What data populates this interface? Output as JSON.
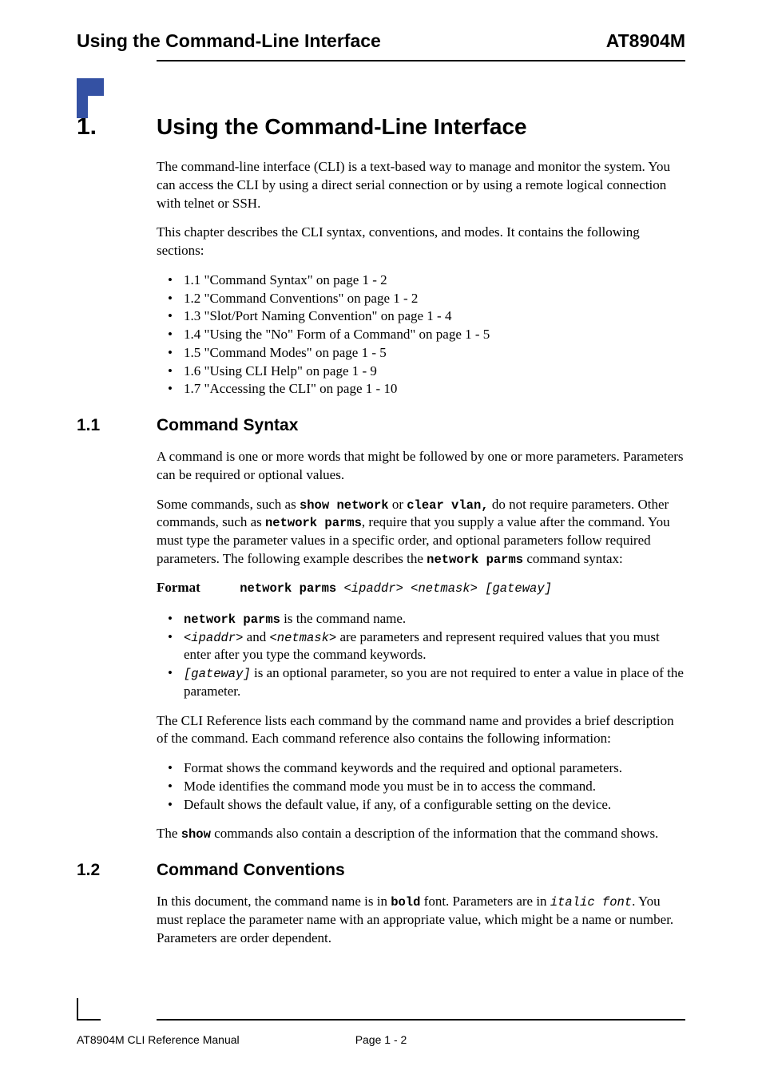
{
  "header": {
    "left": "Using the Command-Line Interface",
    "right": "AT8904M"
  },
  "chapter": {
    "number": "1.",
    "title": "Using the Command-Line Interface"
  },
  "intro": {
    "p1": "The command-line interface (CLI) is a text-based way to manage and monitor the system. You can access the CLI by using a direct serial connection or by using a remote logical connection with telnet or SSH.",
    "p2": "This chapter describes the CLI syntax, conventions, and modes. It contains the following sections:"
  },
  "toc": [
    "1.1 \"Command Syntax\" on page 1 - 2",
    "1.2 \"Command Conventions\" on page 1 - 2",
    "1.3 \"Slot/Port Naming Convention\" on page 1 - 4",
    "1.4 \"Using the \"No\" Form of a Command\" on page 1 - 5",
    "1.5 \"Command Modes\" on page 1 - 5",
    "1.6 \"Using CLI Help\" on page 1 - 9",
    "1.7 \"Accessing the CLI\" on page 1 - 10"
  ],
  "s11": {
    "number": "1.1",
    "title": "Command Syntax",
    "p1": "A command is one or more words that might be followed by one or more parameters. Parameters can be required or optional values.",
    "p2a": "Some commands, such as ",
    "p2_code1": "show network",
    "p2b": " or ",
    "p2_code2": "clear vlan,",
    "p2c": " do not require parameters. Other commands, such as ",
    "p2_code3": "network parms",
    "p2d": ", require that you supply a value after the command. You must type the parameter values in a specific order, and optional parameters follow required parameters. The following example describes the ",
    "p2_code4": "network parms",
    "p2e": " command syntax:",
    "format_label": "Format",
    "format_cmd": "network parms",
    "format_args": " <ipaddr> <netmask> [gateway]",
    "b1_code": "network parms",
    "b1_text": " is the command name.",
    "b2_code1": "<ipaddr>",
    "b2_mid": " and ",
    "b2_code2": "<netmask>",
    "b2_text": " are parameters and represent required values that you must enter after you type the command keywords.",
    "b3_code": "[gateway]",
    "b3_text": " is an optional parameter, so you are not required to enter a value in place of the parameter.",
    "p3": "The CLI Reference lists each command by the command name and provides a brief description of the command. Each command reference also contains the following information:",
    "info": [
      "Format shows the command keywords and the required and optional parameters.",
      "Mode identifies the command mode you must be in to access the command.",
      "Default shows the default value, if any, of a configurable setting on the device."
    ],
    "p4a": "The ",
    "p4_code": "show",
    "p4b": " commands also contain a description of the information that the command shows."
  },
  "s12": {
    "number": "1.2",
    "title": "Command Conventions",
    "p1a": "In this document, the command name is in ",
    "p1_code1": "bold",
    "p1b": " font. Parameters are in ",
    "p1_code2": "italic font",
    "p1c": ". You must replace the parameter name with an appropriate value, which might be a name or number. Parameters are order dependent."
  },
  "footer": {
    "left": "AT8904M CLI Reference Manual",
    "center": "Page 1 - 2"
  }
}
